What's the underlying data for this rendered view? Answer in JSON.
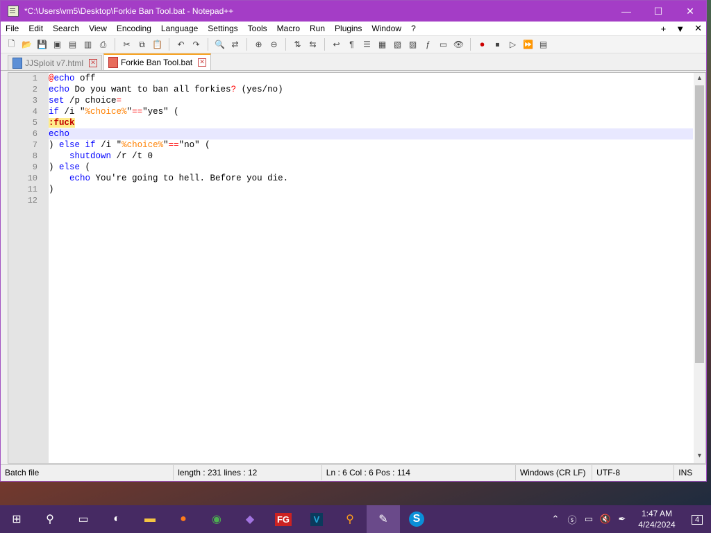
{
  "window": {
    "title": "*C:\\Users\\vm5\\Desktop\\Forkie Ban Tool.bat - Notepad++",
    "minimize": "—",
    "maximize": "☐",
    "close": "✕"
  },
  "menu": {
    "items": [
      "File",
      "Edit",
      "Search",
      "View",
      "Encoding",
      "Language",
      "Settings",
      "Tools",
      "Macro",
      "Run",
      "Plugins",
      "Window",
      "?"
    ],
    "right": [
      "+",
      "▼",
      "✕"
    ]
  },
  "tabs": [
    {
      "label": "JJSploit v7.html",
      "active": false
    },
    {
      "label": "Forkie Ban Tool.bat",
      "active": true
    }
  ],
  "editor": {
    "lines": [
      {
        "num": "1",
        "segments": [
          {
            "t": "@",
            "c": "at"
          },
          {
            "t": "echo",
            "c": "kw"
          },
          {
            "t": " off",
            "c": ""
          }
        ]
      },
      {
        "num": "2",
        "segments": [
          {
            "t": "echo",
            "c": "kw"
          },
          {
            "t": " Do you want to ban all forkies",
            "c": ""
          },
          {
            "t": "?",
            "c": "op"
          },
          {
            "t": " (yes/no)",
            "c": ""
          }
        ]
      },
      {
        "num": "3",
        "segments": [
          {
            "t": "set",
            "c": "kw"
          },
          {
            "t": " /p choice",
            "c": ""
          },
          {
            "t": "=",
            "c": "op"
          }
        ]
      },
      {
        "num": "4",
        "segments": [
          {
            "t": "if",
            "c": "kw"
          },
          {
            "t": " /i \"",
            "c": ""
          },
          {
            "t": "%choice%",
            "c": "var"
          },
          {
            "t": "\"",
            "c": ""
          },
          {
            "t": "==",
            "c": "op"
          },
          {
            "t": "\"yes\" (",
            "c": ""
          }
        ]
      },
      {
        "num": "5",
        "segments": [
          {
            "t": ":fuck",
            "c": "label"
          }
        ]
      },
      {
        "num": "6",
        "segments": [
          {
            "t": "echo",
            "c": "kw"
          }
        ],
        "current": true
      },
      {
        "num": "7",
        "segments": [
          {
            "t": ") ",
            "c": ""
          },
          {
            "t": "else",
            "c": "kw"
          },
          {
            "t": " ",
            "c": ""
          },
          {
            "t": "if",
            "c": "kw"
          },
          {
            "t": " /i \"",
            "c": ""
          },
          {
            "t": "%choice%",
            "c": "var"
          },
          {
            "t": "\"",
            "c": ""
          },
          {
            "t": "==",
            "c": "op"
          },
          {
            "t": "\"no\" (",
            "c": ""
          }
        ]
      },
      {
        "num": "8",
        "segments": [
          {
            "t": "    ",
            "c": ""
          },
          {
            "t": "shutdown",
            "c": "kw"
          },
          {
            "t": " /r /t 0",
            "c": ""
          }
        ]
      },
      {
        "num": "9",
        "segments": [
          {
            "t": ") ",
            "c": ""
          },
          {
            "t": "else",
            "c": "kw"
          },
          {
            "t": " (",
            "c": ""
          }
        ]
      },
      {
        "num": "10",
        "segments": [
          {
            "t": "    ",
            "c": ""
          },
          {
            "t": "echo",
            "c": "kw"
          },
          {
            "t": " You're going to hell. Before you die.",
            "c": ""
          }
        ]
      },
      {
        "num": "11",
        "segments": [
          {
            "t": ")",
            "c": ""
          }
        ]
      },
      {
        "num": "12",
        "segments": []
      }
    ]
  },
  "status": {
    "filetype": "Batch file",
    "length": "length : 231    lines : 12",
    "position": "Ln : 6    Col : 6    Pos : 114",
    "eol": "Windows (CR LF)",
    "encoding": "UTF-8",
    "mode": "INS"
  },
  "taskbar": {
    "time": "1:47 AM",
    "date": "4/24/2024",
    "notifications": "4",
    "apps": [
      "start-icon",
      "search-icon",
      "task-view-icon",
      "edge-icon",
      "file-explorer-icon",
      "firefox-icon",
      "chrome-icon",
      "visual-studio-icon",
      "fg-icon",
      "v-icon",
      "magnifier-icon",
      "notepadpp-icon",
      "skype-icon"
    ],
    "fg_label": "FG",
    "v_label": "V",
    "s_label": "S"
  }
}
